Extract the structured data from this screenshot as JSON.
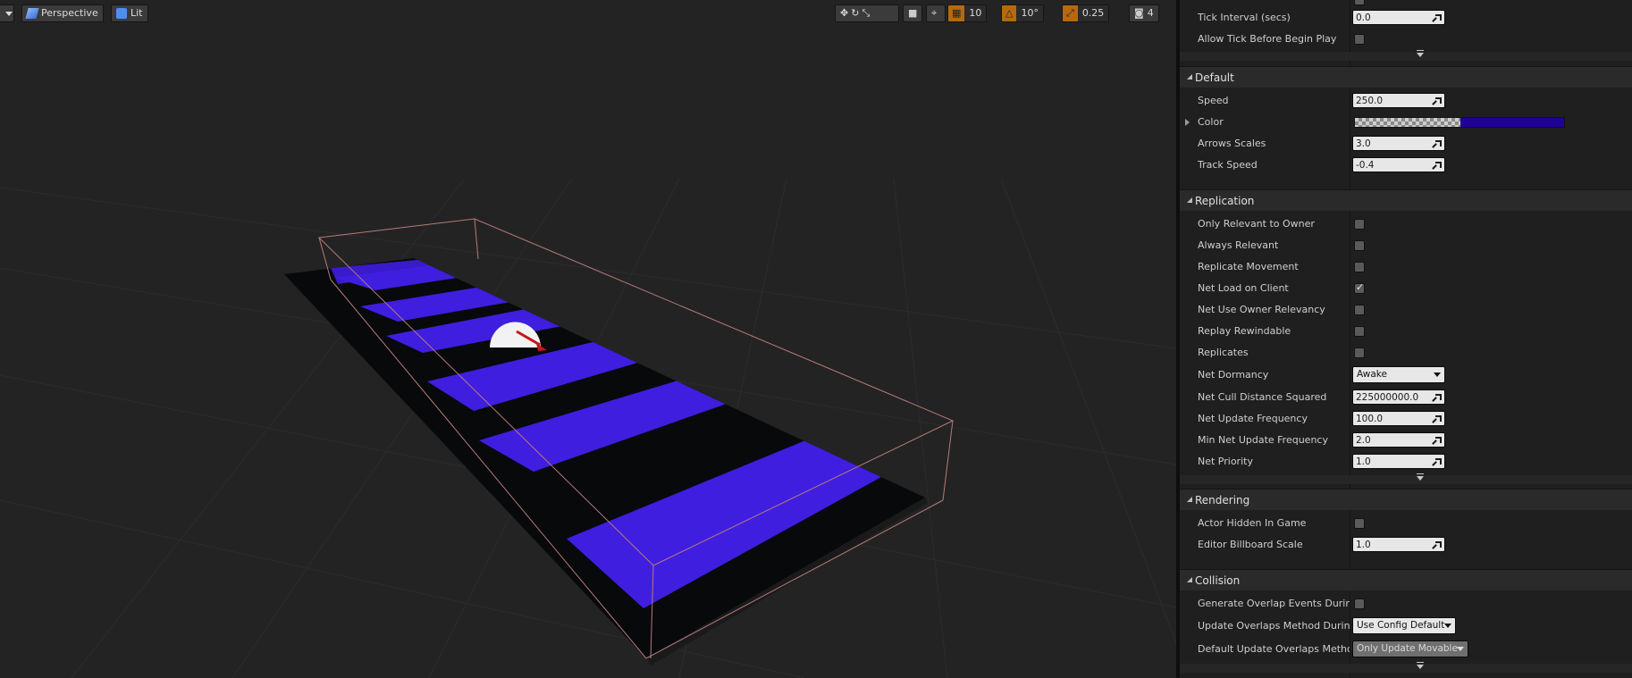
{
  "viewport": {
    "view_mode": "Perspective",
    "lighting_mode": "Lit",
    "grid_snap": "10",
    "rotation_snap": "10°",
    "scale_snap": "0.25",
    "camera_speed": "4",
    "track_color": "#3f1ee0",
    "track_dark": "#07090b"
  },
  "details": {
    "tick_interval": {
      "label": "Tick Interval (secs)",
      "value": "0.0"
    },
    "allow_tick": {
      "label": "Allow Tick Before Begin Play"
    },
    "default_section": {
      "title": "Default",
      "speed": {
        "label": "Speed",
        "value": "250.0"
      },
      "color": {
        "label": "Color",
        "value_hex": "#1f0099"
      },
      "arrows_scales": {
        "label": "Arrows Scales",
        "value": "3.0"
      },
      "track_speed": {
        "label": "Track Speed",
        "value": "-0.4"
      }
    },
    "replication_section": {
      "title": "Replication",
      "only_relevant_to_owner": {
        "label": "Only Relevant to Owner",
        "checked": false
      },
      "always_relevant": {
        "label": "Always Relevant",
        "checked": false
      },
      "replicate_movement": {
        "label": "Replicate Movement",
        "checked": false
      },
      "net_load_on_client": {
        "label": "Net Load on Client",
        "checked": true
      },
      "net_use_owner_relevancy": {
        "label": "Net Use Owner Relevancy",
        "checked": false
      },
      "replay_rewindable": {
        "label": "Replay Rewindable",
        "checked": false
      },
      "replicates": {
        "label": "Replicates",
        "checked": false
      },
      "net_dormancy": {
        "label": "Net Dormancy",
        "value": "Awake"
      },
      "net_cull_distance": {
        "label": "Net Cull Distance Squared",
        "value": "225000000.0"
      },
      "net_update_frequency": {
        "label": "Net Update Frequency",
        "value": "100.0"
      },
      "min_net_update_frequency": {
        "label": "Min Net Update Frequency",
        "value": "2.0"
      },
      "net_priority": {
        "label": "Net Priority",
        "value": "1.0"
      }
    },
    "rendering_section": {
      "title": "Rendering",
      "actor_hidden": {
        "label": "Actor Hidden In Game",
        "checked": false
      },
      "billboard_scale": {
        "label": "Editor Billboard Scale",
        "value": "1.0"
      }
    },
    "collision_section": {
      "title": "Collision",
      "generate_overlap": {
        "label": "Generate Overlap Events During Le",
        "checked": false
      },
      "update_overlaps": {
        "label": "Update Overlaps Method During Le",
        "value": "Use Config Default"
      },
      "default_update_overlaps": {
        "label": "Default Update Overlaps Method D",
        "value": "Only Update Movable"
      }
    }
  }
}
